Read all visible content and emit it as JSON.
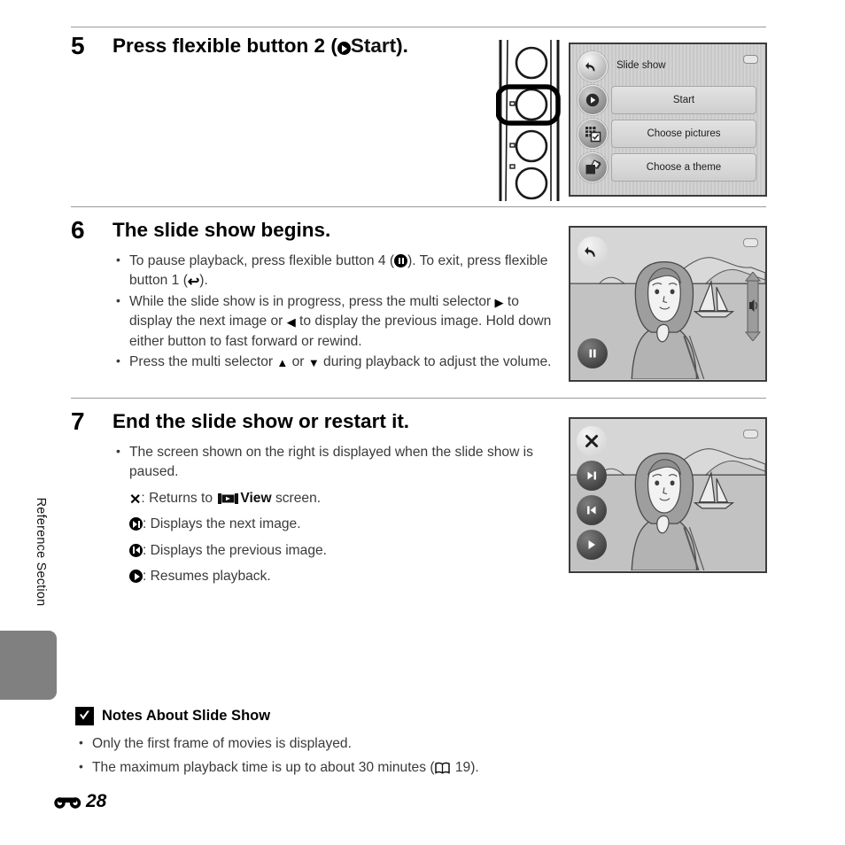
{
  "page": {
    "side_label": "Reference Section",
    "footer_page": "28",
    "footer_icon": "reference-section-icon"
  },
  "steps": [
    {
      "number": "5",
      "heading_before": "Press flexible button 2 (",
      "heading_icon": "play-circle-icon",
      "heading_bold": "Start",
      "heading_after": ")."
    },
    {
      "number": "6",
      "heading": "The slide show begins.",
      "bullets": [
        {
          "parts": [
            {
              "t": "text",
              "v": "To pause playback, press flexible button 4 ("
            },
            {
              "t": "icon",
              "v": "pause-circle-icon"
            },
            {
              "t": "text",
              "v": "). To exit, press flexible button 1 ("
            },
            {
              "t": "icon",
              "v": "back-arrow-icon"
            },
            {
              "t": "text",
              "v": ")."
            }
          ]
        },
        {
          "parts": [
            {
              "t": "text",
              "v": "While the slide show is in progress, press the multi selector "
            },
            {
              "t": "icon",
              "v": "triangle-right-icon"
            },
            {
              "t": "text",
              "v": " to display the next image or "
            },
            {
              "t": "icon",
              "v": "triangle-left-icon"
            },
            {
              "t": "text",
              "v": " to display the previous image. Hold down either button to fast forward or rewind."
            }
          ]
        },
        {
          "parts": [
            {
              "t": "text",
              "v": "Press the multi selector "
            },
            {
              "t": "icon",
              "v": "triangle-up-icon"
            },
            {
              "t": "text",
              "v": " or "
            },
            {
              "t": "icon",
              "v": "triangle-down-icon"
            },
            {
              "t": "text",
              "v": " during playback to adjust the volume."
            }
          ]
        }
      ]
    },
    {
      "number": "7",
      "heading": "End the slide show or restart it.",
      "bullets": [
        {
          "parts": [
            {
              "t": "text",
              "v": "The screen shown on the right is displayed when the slide show is paused."
            }
          ]
        }
      ],
      "key_lines": [
        {
          "icon": "x-mark-icon",
          "parts": [
            {
              "t": "text",
              "v": ": Returns to "
            },
            {
              "t": "icon",
              "v": "view-filmstrip-icon"
            },
            {
              "t": "bold",
              "v": "View"
            },
            {
              "t": "text",
              "v": " screen."
            }
          ]
        },
        {
          "icon": "next-frame-circle-icon",
          "parts": [
            {
              "t": "text",
              "v": ": Displays the next image."
            }
          ]
        },
        {
          "icon": "previous-frame-circle-icon",
          "parts": [
            {
              "t": "text",
              "v": ": Displays the previous image."
            }
          ]
        },
        {
          "icon": "play-circle-icon",
          "parts": [
            {
              "t": "text",
              "v": ": Resumes playback."
            }
          ]
        }
      ]
    }
  ],
  "menu_screen": {
    "title": "Slide show",
    "title_icon": "back-arrow-icon",
    "items": [
      {
        "label": "Start",
        "icon": "play-icon"
      },
      {
        "label": "Choose pictures",
        "icon": "choose-pictures-icon"
      },
      {
        "label": "Choose a theme",
        "icon": "choose-theme-icon"
      }
    ],
    "battery_icon": "battery-icon"
  },
  "playback_screen": {
    "buttons": [
      {
        "icon": "back-arrow-icon"
      },
      {
        "icon": "pause-icon"
      }
    ],
    "volume_slider_icon": "speaker-icon",
    "battery_icon": "battery-icon"
  },
  "paused_screen": {
    "buttons": [
      {
        "icon": "x-mark-icon"
      },
      {
        "icon": "next-frame-icon"
      },
      {
        "icon": "previous-frame-icon"
      },
      {
        "icon": "play-icon"
      }
    ],
    "battery_icon": "battery-icon"
  },
  "notes": {
    "heading": "Notes About Slide Show",
    "heading_icon": "checkmark-box-icon",
    "items": [
      {
        "parts": [
          {
            "t": "text",
            "v": "Only the first frame of movies is displayed."
          }
        ]
      },
      {
        "parts": [
          {
            "t": "text",
            "v": "The maximum playback time is up to about 30 minutes ("
          },
          {
            "t": "icon",
            "v": "book-icon"
          },
          {
            "t": "text",
            "v": " 19)."
          }
        ]
      }
    ]
  },
  "colors": {
    "rule": "#9a9a9a",
    "tab": "#808080",
    "screen_border": "#3c3c3c",
    "body_text": "#3a3a3a"
  }
}
